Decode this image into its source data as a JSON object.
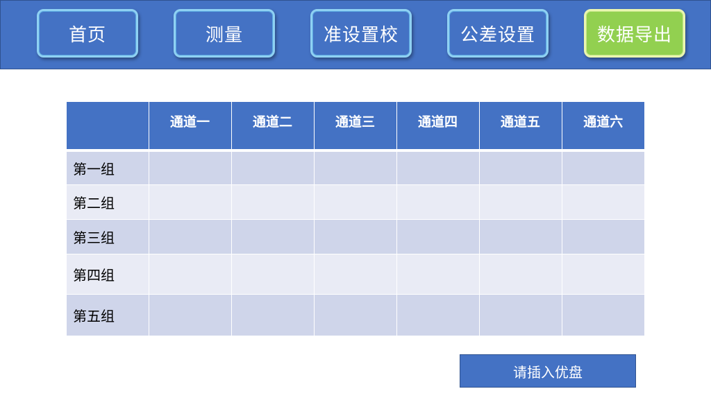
{
  "nav": {
    "items": [
      {
        "label": "首页",
        "active": false
      },
      {
        "label": "测量",
        "active": false
      },
      {
        "label": "准设置校",
        "active": false
      },
      {
        "label": "公差设置",
        "active": false
      },
      {
        "label": "数据导出",
        "active": true
      }
    ]
  },
  "table": {
    "corner": "",
    "columns": [
      "通道一",
      "通道二",
      "通道三",
      "通道四",
      "通道五",
      "通道六"
    ],
    "rows": [
      {
        "label": "第一组",
        "cells": [
          "",
          "",
          "",
          "",
          "",
          ""
        ]
      },
      {
        "label": "第二组",
        "cells": [
          "",
          "",
          "",
          "",
          "",
          ""
        ]
      },
      {
        "label": "第三组",
        "cells": [
          "",
          "",
          "",
          "",
          "",
          ""
        ]
      },
      {
        "label": "第四组",
        "cells": [
          "",
          "",
          "",
          "",
          "",
          ""
        ]
      },
      {
        "label": "第五组",
        "cells": [
          "",
          "",
          "",
          "",
          "",
          ""
        ]
      }
    ]
  },
  "export": {
    "usb_label": "请插入优盘"
  },
  "colors": {
    "primary": "#4472c4",
    "active": "#92d050",
    "row_odd": "#cfd5ea",
    "row_even": "#e9ebf5"
  }
}
